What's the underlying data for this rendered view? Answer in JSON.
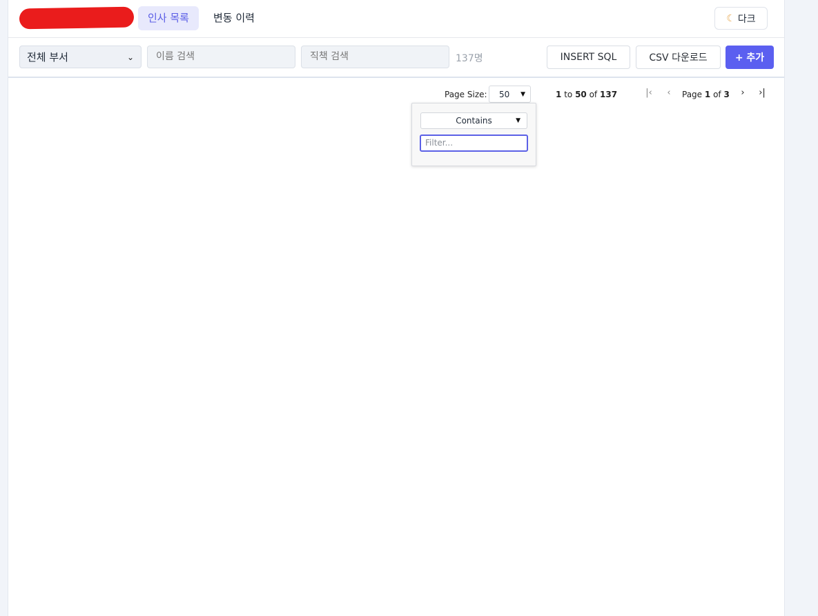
{
  "header": {
    "tabs": [
      {
        "label": "인사 목록",
        "active": true
      },
      {
        "label": "변동 이력",
        "active": false
      }
    ],
    "theme_button": {
      "icon": "moon-icon",
      "label": "다크"
    }
  },
  "toolbar": {
    "department_select": {
      "value": "전체 부서"
    },
    "name_search": {
      "placeholder": "이름 검색"
    },
    "title_search": {
      "placeholder": "직책 검색"
    },
    "count": "137명",
    "insert_sql_label": "INSERT SQL",
    "csv_label": "CSV 다운로드",
    "add_label": "+ 추가"
  },
  "grid": {
    "page_size_label": "Page Size:",
    "page_size_value": "50",
    "range_from": "1",
    "range_to_word": "to",
    "range_to": "50",
    "range_of_word": "of",
    "range_total": "137",
    "page_word": "Page",
    "page_current": "1",
    "page_of_word": "of",
    "page_total": "3"
  },
  "filter_popup": {
    "type_value": "Contains",
    "input_placeholder": "Filter..."
  },
  "colors": {
    "accent": "#5b5ff0",
    "active_tab_bg": "#e8e9fc",
    "logo": "#ea1c1c"
  }
}
